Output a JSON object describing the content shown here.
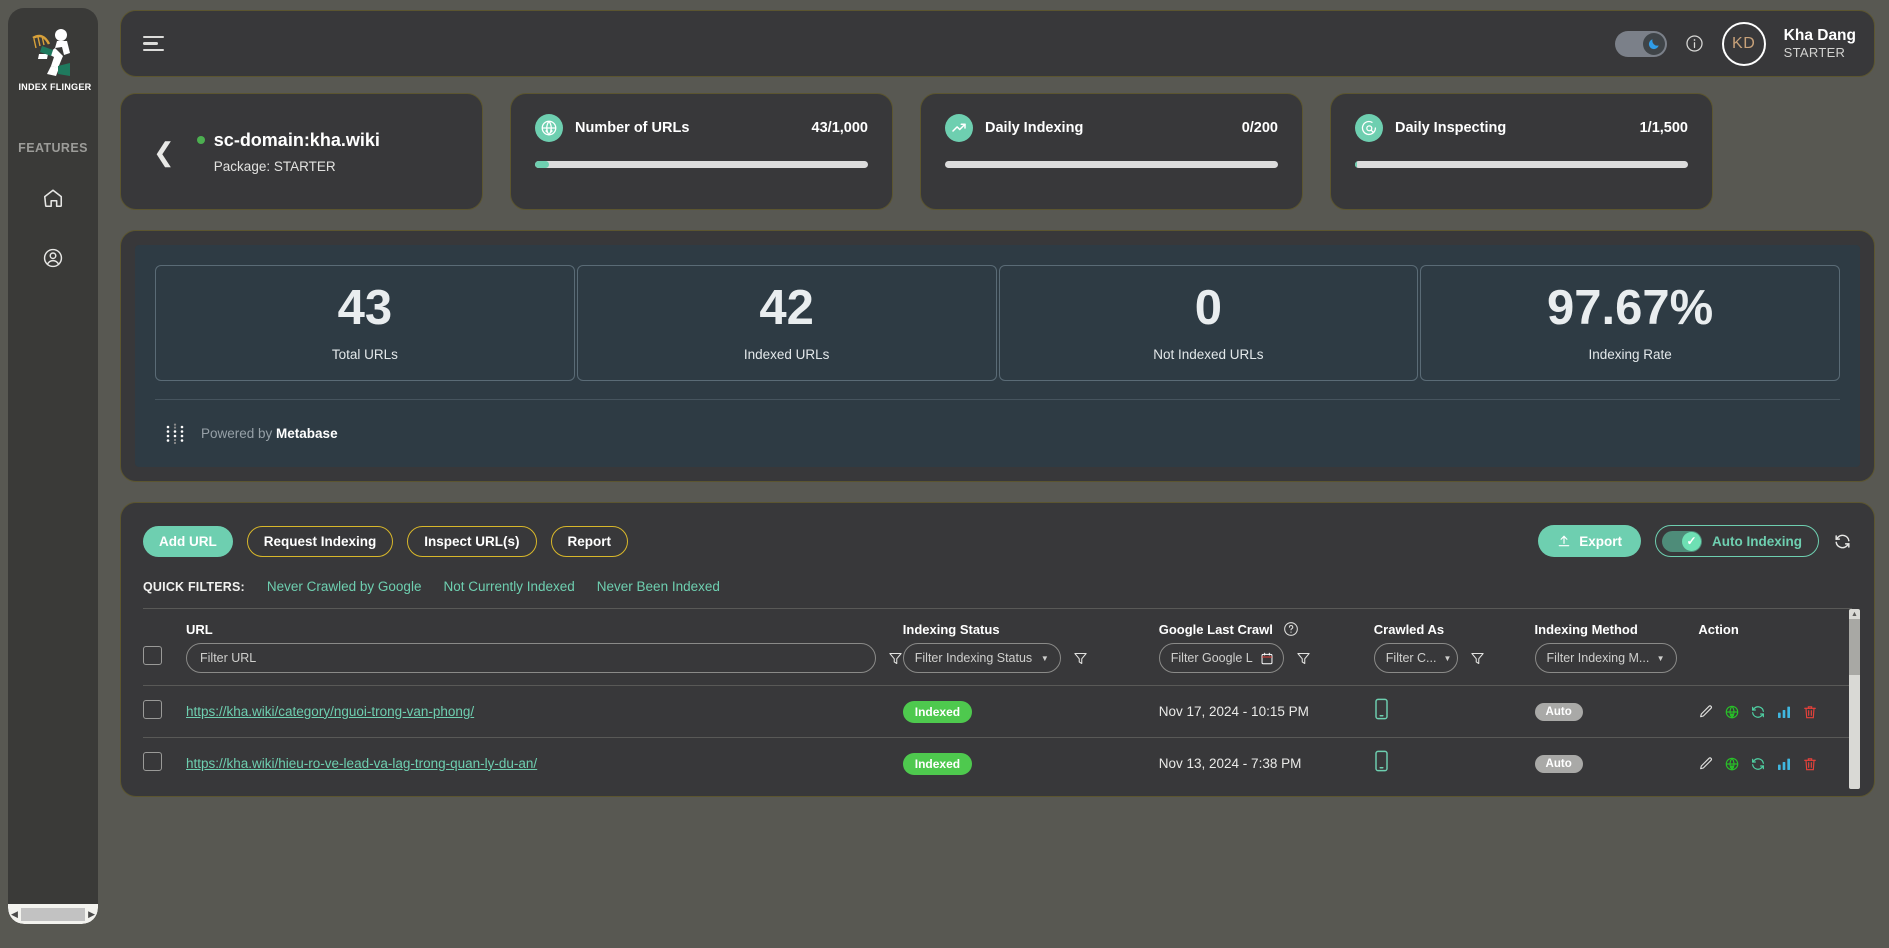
{
  "sidebar": {
    "logo_text": "INDEX FLINGER",
    "section_label": "FEATURES",
    "items": [
      {
        "icon": "home-icon",
        "label": "Home"
      },
      {
        "icon": "account-icon",
        "label": "Account"
      }
    ]
  },
  "topbar": {
    "menu_icon": "hamburger-icon",
    "dark_mode_icon": "moon-icon",
    "dark_mode_on": true,
    "info_icon": "info-circle-icon",
    "avatar_initials": "KD",
    "user_name": "Kha Dang",
    "user_plan": "STARTER"
  },
  "domain_card": {
    "back_icon": "chevron-left-icon",
    "status": "active",
    "title": "sc-domain:kha.wiki",
    "package": "Package: STARTER"
  },
  "meters": [
    {
      "icon": "globe-code-icon",
      "label": "Number of URLs",
      "value": "43/1,000",
      "percent": 4.3
    },
    {
      "icon": "trending-up-icon",
      "label": "Daily Indexing",
      "value": "0/200",
      "percent": 0
    },
    {
      "icon": "inspect-search-icon",
      "label": "Daily Inspecting",
      "value": "1/1,500",
      "percent": 0.07
    }
  ],
  "metabase": {
    "cards": [
      {
        "value": "43",
        "caption": "Total URLs"
      },
      {
        "value": "42",
        "caption": "Indexed URLs"
      },
      {
        "value": "0",
        "caption": "Not Indexed URLs"
      },
      {
        "value": "97.67%",
        "caption": "Indexing Rate"
      }
    ],
    "powered_prefix": "Powered by ",
    "powered_brand": "Metabase"
  },
  "toolbar": {
    "add_url": "Add URL",
    "request_indexing": "Request Indexing",
    "inspect_urls": "Inspect URL(s)",
    "report": "Report",
    "export": "Export",
    "export_icon": "upload-icon",
    "auto_indexing": "Auto Indexing",
    "auto_indexing_on": true,
    "refresh_icon": "refresh-icon"
  },
  "quick_filters": {
    "label": "QUICK FILTERS:",
    "items": [
      "Never Crawled by Google",
      "Not Currently Indexed",
      "Never Been Indexed"
    ]
  },
  "table": {
    "headers": {
      "url": "URL",
      "indexing_status": "Indexing Status",
      "google_last_crawl": "Google Last Crawl",
      "crawled_as": "Crawled As",
      "indexing_method": "Indexing Method",
      "action": "Action"
    },
    "filters": {
      "url_placeholder": "Filter URL",
      "indexing_status": "Filter Indexing Status",
      "google_last_crawl": "Filter Google L",
      "crawled_as": "Filter C...",
      "indexing_method": "Filter Indexing M..."
    },
    "rows": [
      {
        "url": "https://kha.wiki/category/nguoi-trong-van-phong/",
        "status": "Indexed",
        "last_crawl": "Nov 17, 2024 - 10:15 PM",
        "crawled_as": "mobile",
        "method": "Auto"
      },
      {
        "url": "https://kha.wiki/hieu-ro-ve-lead-va-lag-trong-quan-ly-du-an/",
        "status": "Indexed",
        "last_crawl": "Nov 13, 2024 - 7:38 PM",
        "crawled_as": "mobile",
        "method": "Auto"
      }
    ]
  },
  "colors": {
    "accent_teal": "#6ecfb0",
    "accent_yellow": "#d8b72a",
    "status_green": "#4ec94e",
    "danger_red": "#e8413a"
  }
}
